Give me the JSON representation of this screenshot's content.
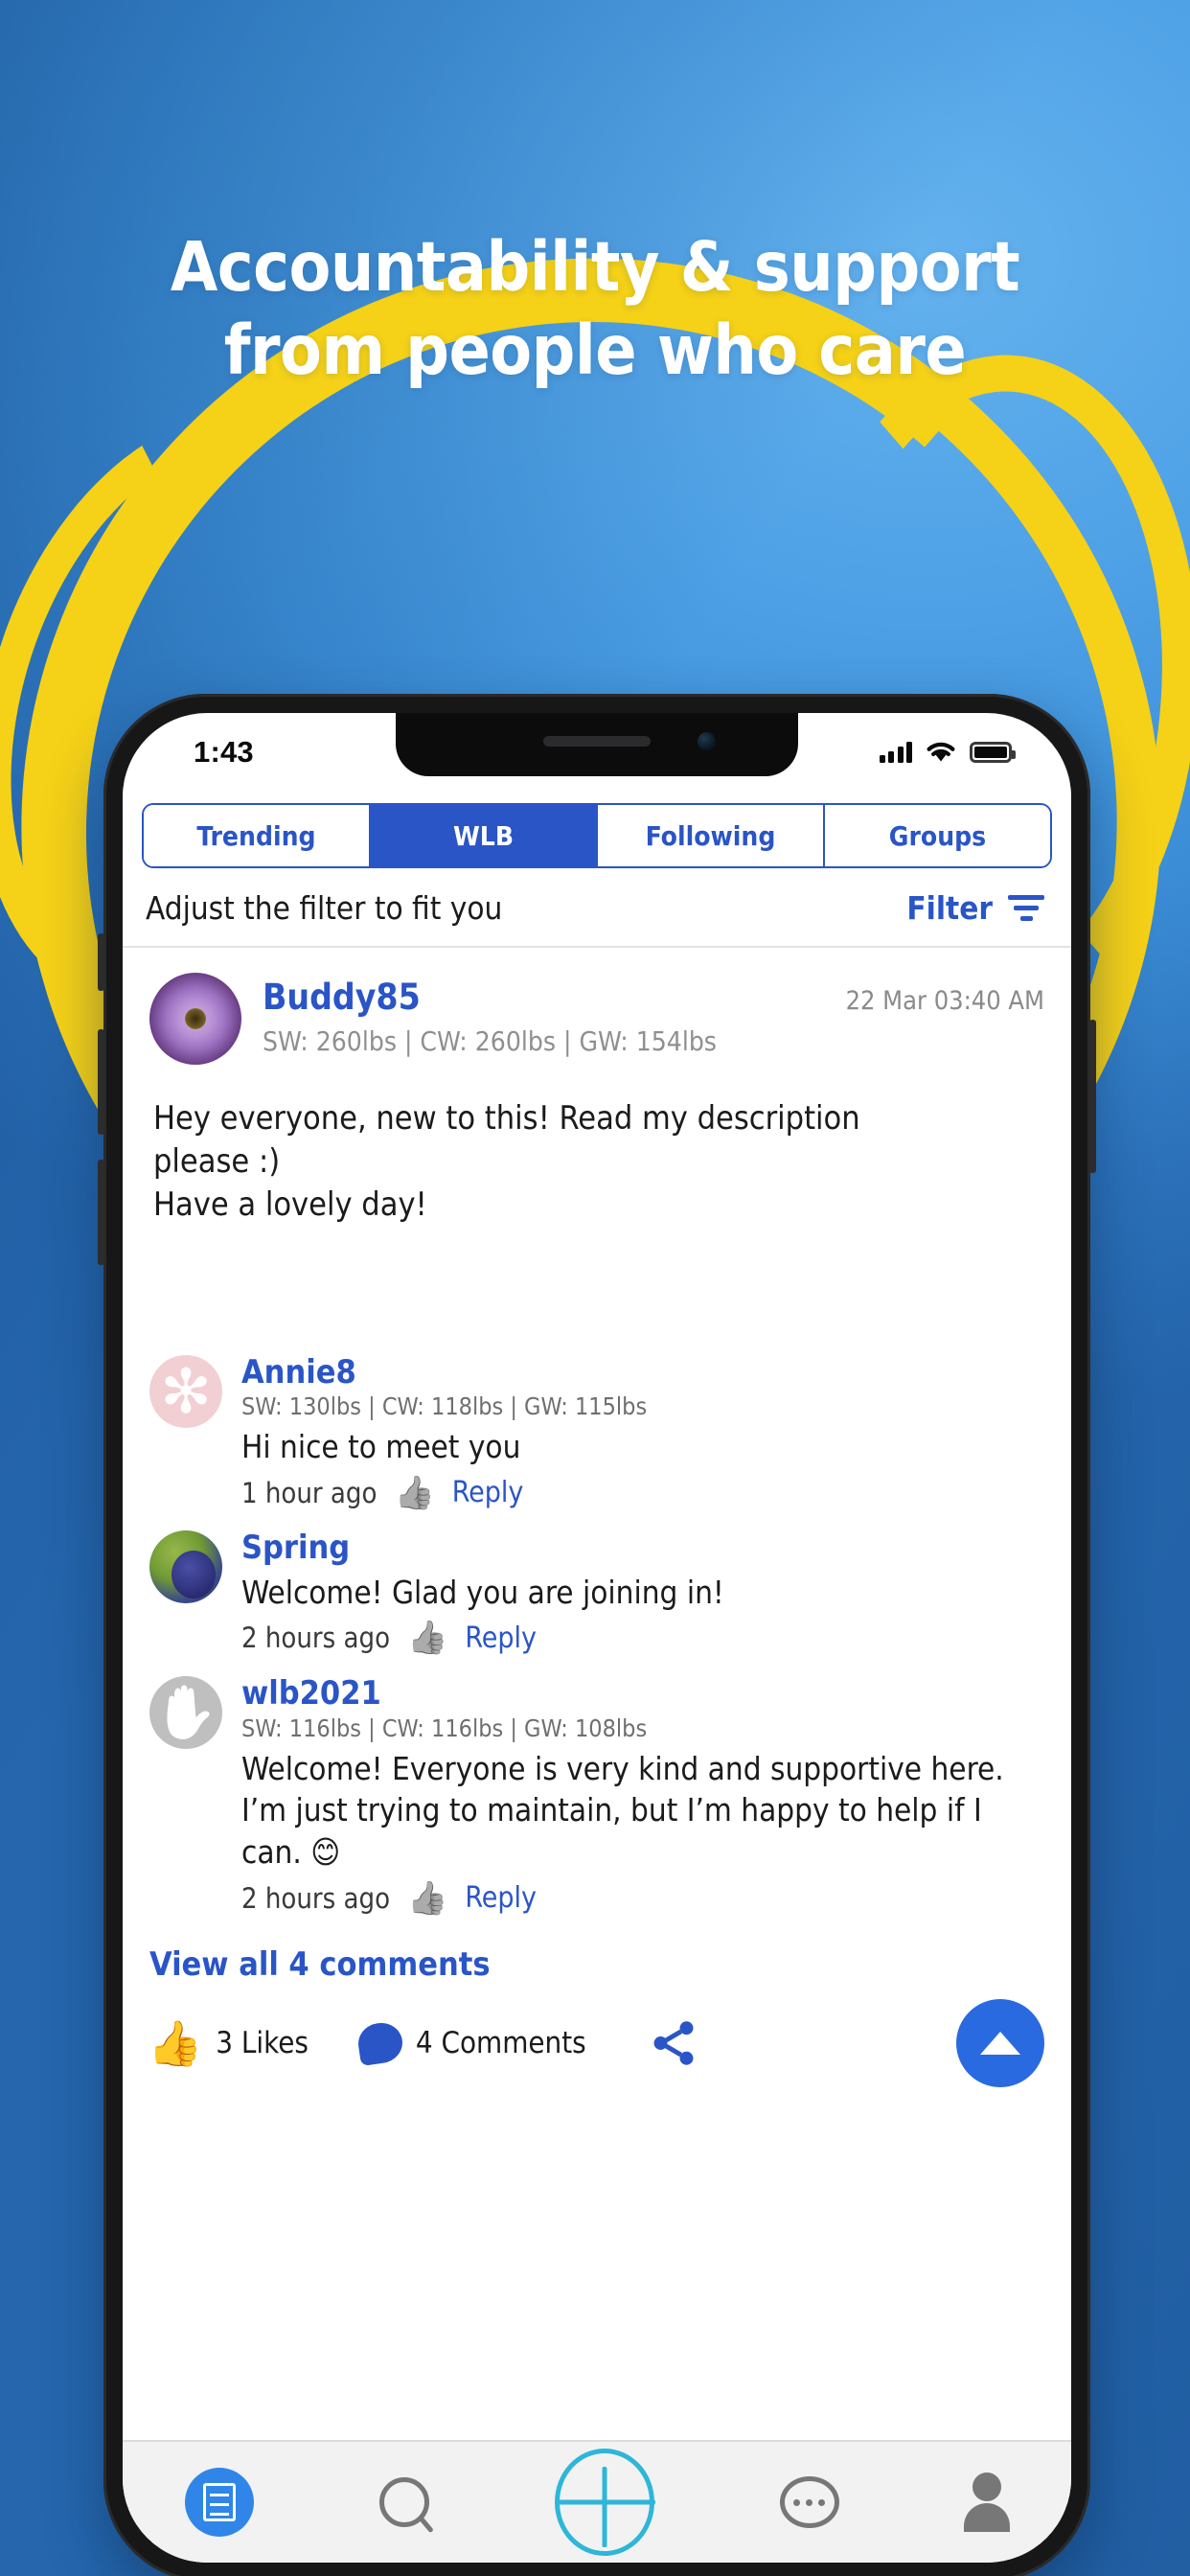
{
  "marketing": {
    "headline_line1": "Accountability & support",
    "headline_line2": "from people who care",
    "bg_color": "#3c8fd8",
    "accent_color": "#f5d117"
  },
  "statusbar": {
    "time": "1:43",
    "signal_icon": "signal-bars-icon",
    "wifi_icon": "wifi-icon",
    "battery_icon": "battery-full-icon"
  },
  "app": {
    "accent_blue": "#2a55c7",
    "tabs": [
      {
        "label": "Trending",
        "active": false
      },
      {
        "label": "WLB",
        "active": true
      },
      {
        "label": "Following",
        "active": false
      },
      {
        "label": "Groups",
        "active": false
      }
    ],
    "filter": {
      "hint": "Adjust the filter to fit you",
      "button_label": "Filter",
      "icon": "filter-icon"
    },
    "post": {
      "author": "Buddy85",
      "timestamp": "22 Mar 03:40 AM",
      "stats": "SW: 260lbs | CW: 260lbs | GW: 154lbs",
      "body_line1": "Hey everyone, new to this! Read my description",
      "body_line2": "please :)",
      "body_line3": "Have a lovely day!",
      "avatar": "flower-avatar"
    },
    "comments": [
      {
        "author": "Annie8",
        "stats": "SW: 130lbs | CW: 118lbs | GW: 115lbs",
        "text": "Hi nice to meet you",
        "time": "1 hour ago",
        "reply_label": "Reply",
        "thumb_icon": "thumbs-up-icon",
        "avatar": "chandelier-avatar"
      },
      {
        "author": "Spring",
        "stats": "",
        "text": "Welcome!  Glad you are joining in!",
        "time": "2 hours ago",
        "reply_label": "Reply",
        "thumb_icon": "thumbs-up-icon",
        "avatar": "berry-avatar"
      },
      {
        "author": "wlb2021",
        "stats": "SW: 116lbs | CW: 116lbs | GW: 108lbs",
        "text": "Welcome! Everyone is very kind and supportive here. I’m just trying to maintain, but I’m happy to help if I can. 😊",
        "time": "2 hours ago",
        "reply_label": "Reply",
        "thumb_icon": "thumbs-up-icon",
        "avatar": "hand-avatar"
      }
    ],
    "view_all_label": "View all 4 comments",
    "actions": {
      "likes_label": "3 Likes",
      "comments_label": "4 Comments",
      "like_icon": "thumbs-up-icon",
      "comment_icon": "comment-bubble-icon",
      "share_icon": "share-icon",
      "scroll_top_icon": "scroll-to-top-icon"
    },
    "bottom_nav": [
      {
        "icon": "feed-icon",
        "active": true
      },
      {
        "icon": "search-icon",
        "active": false
      },
      {
        "icon": "add-post-icon",
        "active": false
      },
      {
        "icon": "more-icon",
        "active": false
      },
      {
        "icon": "profile-icon",
        "active": false
      }
    ]
  }
}
